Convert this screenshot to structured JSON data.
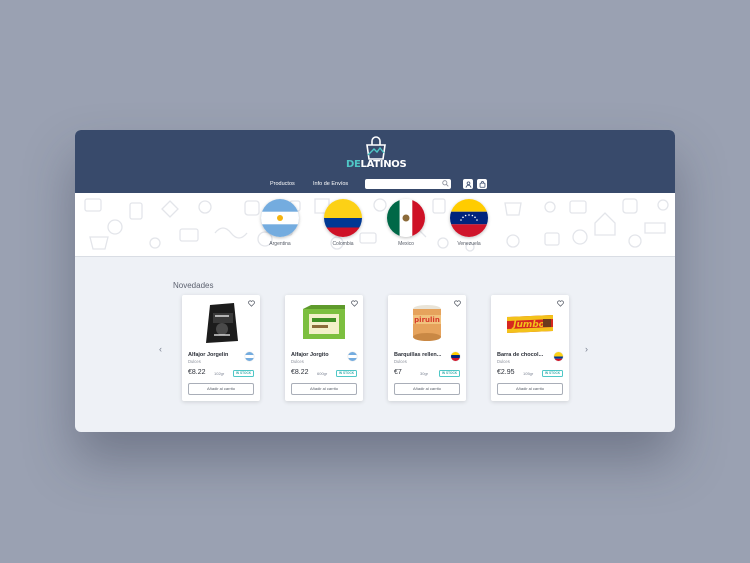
{
  "brand": {
    "prefix": "DE",
    "name": "LATINOS"
  },
  "nav": {
    "products": "Productos",
    "shipping": "Info de Envíos"
  },
  "search": {
    "placeholder": ""
  },
  "countries": [
    {
      "name": "Argentina"
    },
    {
      "name": "Colombia"
    },
    {
      "name": "Mexico"
    },
    {
      "name": "Venezuela"
    }
  ],
  "section": {
    "title": "Novedades"
  },
  "products": [
    {
      "name": "Alfajor Jorgelin",
      "category": "Dulces",
      "price": "€8.22",
      "weight": "102gr",
      "stock": "IN STOCK",
      "button": "Añadir al carrito",
      "origin": "argentina"
    },
    {
      "name": "Alfajor Jorgito",
      "category": "Dulces",
      "price": "€8.22",
      "weight": "600gr",
      "stock": "IN STOCK",
      "button": "Añadir al carrito",
      "origin": "argentina"
    },
    {
      "name": "Barquillas rellen...",
      "category": "Dulces",
      "price": "€7",
      "weight": "30gr",
      "stock": "IN STOCK",
      "button": "Añadir al carrito",
      "origin": "venezuela"
    },
    {
      "name": "Barra de chocol...",
      "category": "Dulces",
      "price": "€2.95",
      "weight": "105gr",
      "stock": "IN STOCK",
      "button": "Añadir al carrito",
      "origin": "colombia"
    }
  ],
  "product_images": [
    "jorgelin-package",
    "jorgito-box",
    "pirulin-can",
    "jumbo-bar"
  ],
  "product_labels": {
    "pirulin": "pirulin",
    "jumbo": "Jumbo"
  },
  "colors": {
    "header": "#384a6b",
    "accent": "#4fc7c6",
    "background": "#9aa1b2"
  },
  "icons": [
    "search-icon",
    "user-icon",
    "cart-icon",
    "heart-icon",
    "chevron-left-icon",
    "chevron-right-icon"
  ]
}
